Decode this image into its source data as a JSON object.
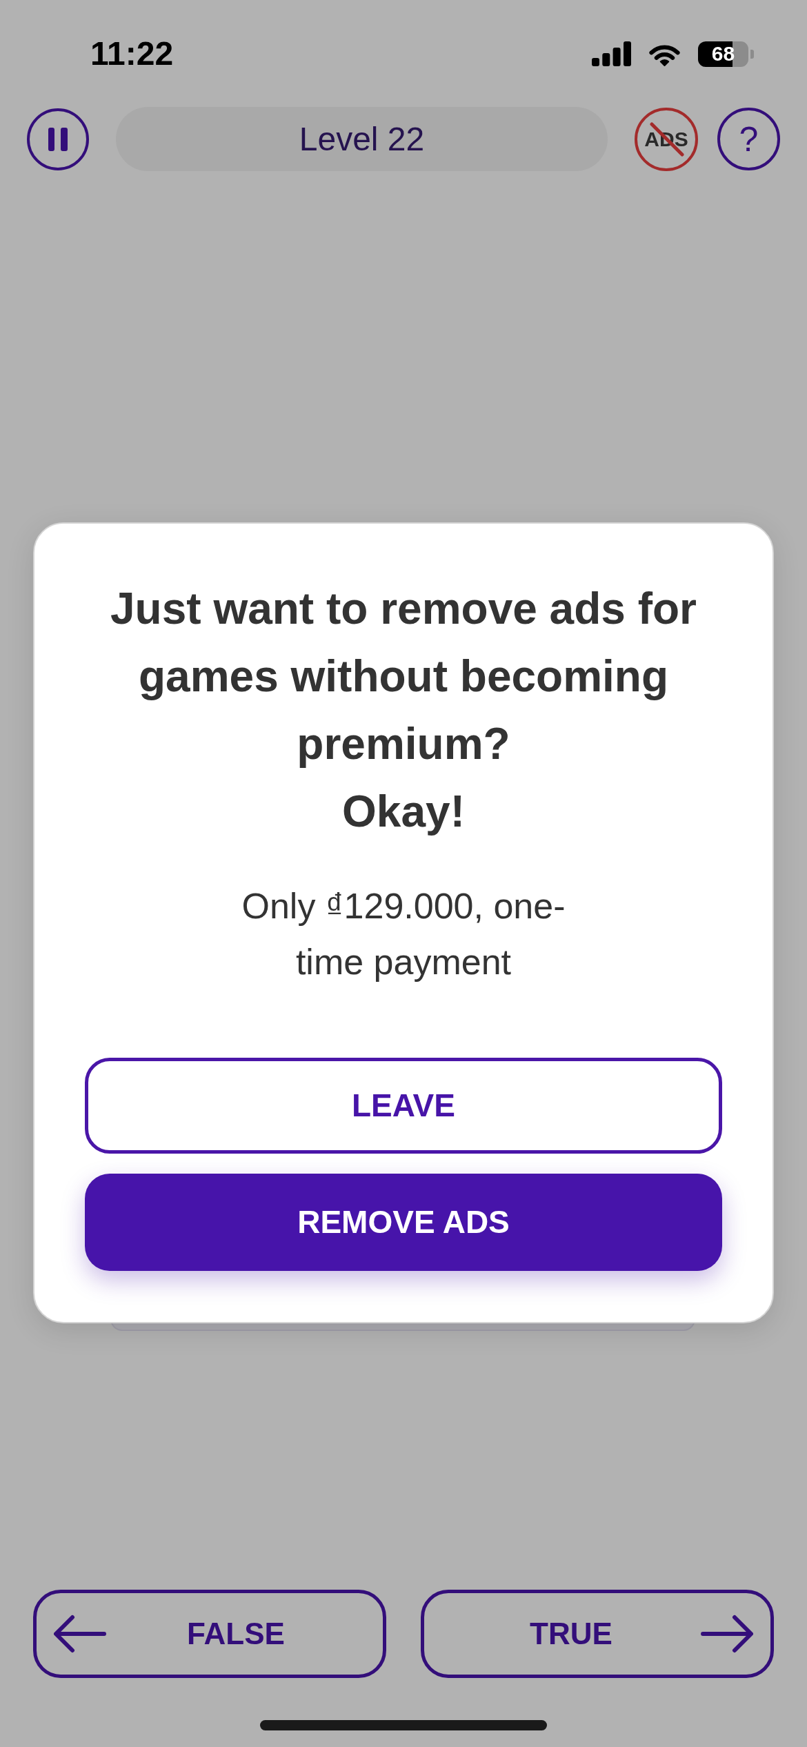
{
  "status_bar": {
    "time": "11:22",
    "battery": "68"
  },
  "top_bar": {
    "level_title": "Level 22",
    "no_ads_label": "ADS",
    "help_label": "?"
  },
  "dialog": {
    "title": "Just want to remove ads for games without becoming premium?\nOkay!",
    "message": "Only ₫129.000, one-time payment",
    "buttons": [
      {
        "label": "LEAVE",
        "kind": "outline"
      },
      {
        "label": "REMOVE ADS",
        "kind": "filled"
      }
    ]
  },
  "answer_buttons": [
    {
      "label": "FALSE",
      "kind": "left"
    },
    {
      "label": "TRUE",
      "kind": "right"
    }
  ]
}
